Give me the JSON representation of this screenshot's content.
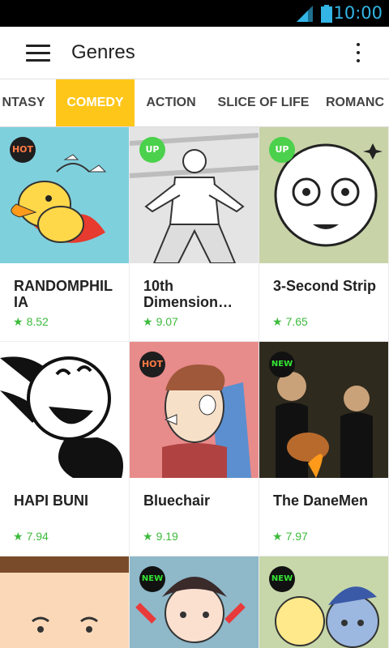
{
  "status": {
    "time": "10:00"
  },
  "appbar": {
    "title": "Genres"
  },
  "tabs": [
    {
      "label": "NTASY"
    },
    {
      "label": "COMEDY"
    },
    {
      "label": "ACTION"
    },
    {
      "label": "SLICE OF LIFE"
    },
    {
      "label": "ROMANC"
    }
  ],
  "cards": [
    {
      "title": "RANDOMPHIL IA",
      "rating": "8.52",
      "badge": "HOT"
    },
    {
      "title": "10th Dimension…",
      "rating": "9.07",
      "badge": "UP"
    },
    {
      "title": "3-Second Strip",
      "rating": "7.65",
      "badge": "UP"
    },
    {
      "title": "HAPI BUNI",
      "rating": "7.94",
      "badge": ""
    },
    {
      "title": "Bluechair",
      "rating": "9.19",
      "badge": "HOT"
    },
    {
      "title": "The DaneMen",
      "rating": "7.97",
      "badge": "NEW"
    },
    {
      "badge": ""
    },
    {
      "badge": "NEW"
    },
    {
      "badge": "NEW"
    }
  ],
  "colors": {
    "accent": "#ffc61a",
    "rating": "#3dbb3d",
    "status": "#33b5e5"
  },
  "star_glyph": "★"
}
